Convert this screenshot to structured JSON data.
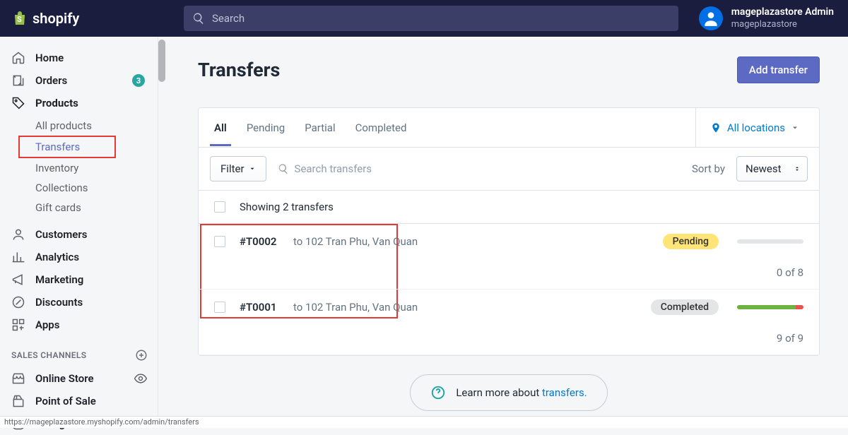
{
  "header": {
    "logo_text": "shopify",
    "search_placeholder": "Search",
    "user_name": "mageplazastore Admin",
    "user_store": "mageplazastore"
  },
  "sidebar": {
    "home": "Home",
    "orders": "Orders",
    "orders_badge": "3",
    "products": "Products",
    "sub_products": {
      "all_products": "All products",
      "transfers": "Transfers",
      "inventory": "Inventory",
      "collections": "Collections",
      "gift_cards": "Gift cards"
    },
    "customers": "Customers",
    "analytics": "Analytics",
    "marketing": "Marketing",
    "discounts": "Discounts",
    "apps": "Apps",
    "sales_channels_header": "SALES CHANNELS",
    "online_store": "Online Store",
    "pos": "Point of Sale",
    "instagram": "Instagram"
  },
  "page": {
    "title": "Transfers",
    "add_button": "Add transfer"
  },
  "tabs": {
    "all": "All",
    "pending": "Pending",
    "partial": "Partial",
    "completed": "Completed",
    "all_locations": "All locations"
  },
  "filters": {
    "filter_label": "Filter",
    "search_placeholder": "Search transfers",
    "sort_label": "Sort by",
    "sort_value": "Newest"
  },
  "summary": "Showing 2 transfers",
  "rows": [
    {
      "id": "#T0002",
      "dest": "to 102 Tran Phu, Van Quan",
      "status": "Pending",
      "count": "0 of 8"
    },
    {
      "id": "#T0001",
      "dest": "to 102 Tran Phu, Van Quan",
      "status": "Completed",
      "count": "9 of 9"
    }
  ],
  "learn": {
    "prefix": "Learn more about ",
    "link": "transfers."
  },
  "status_url": "https://mageplazastore.myshopify.com/admin/transfers"
}
